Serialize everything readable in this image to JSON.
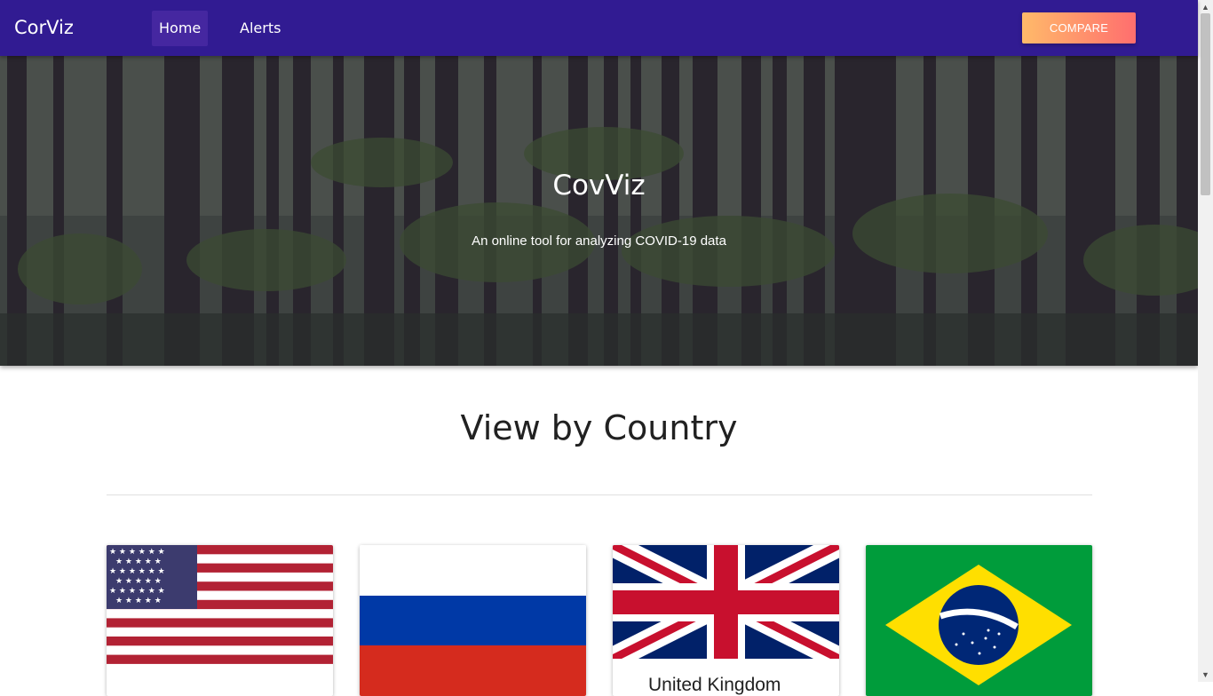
{
  "navbar": {
    "brand": "CorViz",
    "items": [
      {
        "label": "Home",
        "active": true
      },
      {
        "label": "Alerts",
        "active": false
      }
    ],
    "compare_label": "COMPARE",
    "colors": {
      "background": "#311b92",
      "active_item": "#4527a0",
      "compare_gradient": [
        "#ffba6a",
        "#ff6e6e"
      ]
    }
  },
  "hero": {
    "title": "CovViz",
    "subtitle": "An online tool for analyzing COVID-19 data"
  },
  "section": {
    "title": "View by Country"
  },
  "countries": [
    {
      "flag": "us-flag",
      "label": ""
    },
    {
      "flag": "russia-flag",
      "label": ""
    },
    {
      "flag": "uk-flag",
      "label": "United Kingdom"
    },
    {
      "flag": "brazil-flag",
      "label": ""
    }
  ]
}
